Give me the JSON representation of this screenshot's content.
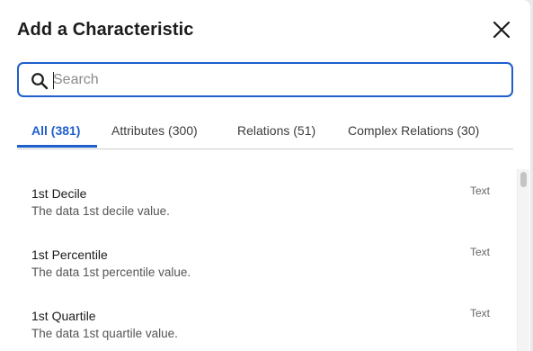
{
  "dialog": {
    "title": "Add a Characteristic"
  },
  "search": {
    "placeholder": "Search",
    "value": ""
  },
  "tabs": [
    {
      "label": "All (381)",
      "active": true
    },
    {
      "label": "Attributes (300)",
      "active": false
    },
    {
      "label": "Relations (51)",
      "active": false
    },
    {
      "label": "Complex Relations (30)",
      "active": false
    }
  ],
  "items": [
    {
      "name": "1st Decile",
      "description": "The data 1st decile value.",
      "type": "Text"
    },
    {
      "name": "1st Percentile",
      "description": "The data 1st percentile value.",
      "type": "Text"
    },
    {
      "name": "1st Quartile",
      "description": "The data 1st quartile value.",
      "type": "Text"
    }
  ],
  "icons": {
    "close": "close-icon",
    "search": "search-icon"
  },
  "colors": {
    "accent": "#1f5fcc",
    "text": "#1c1c1c",
    "muted": "#555555"
  }
}
